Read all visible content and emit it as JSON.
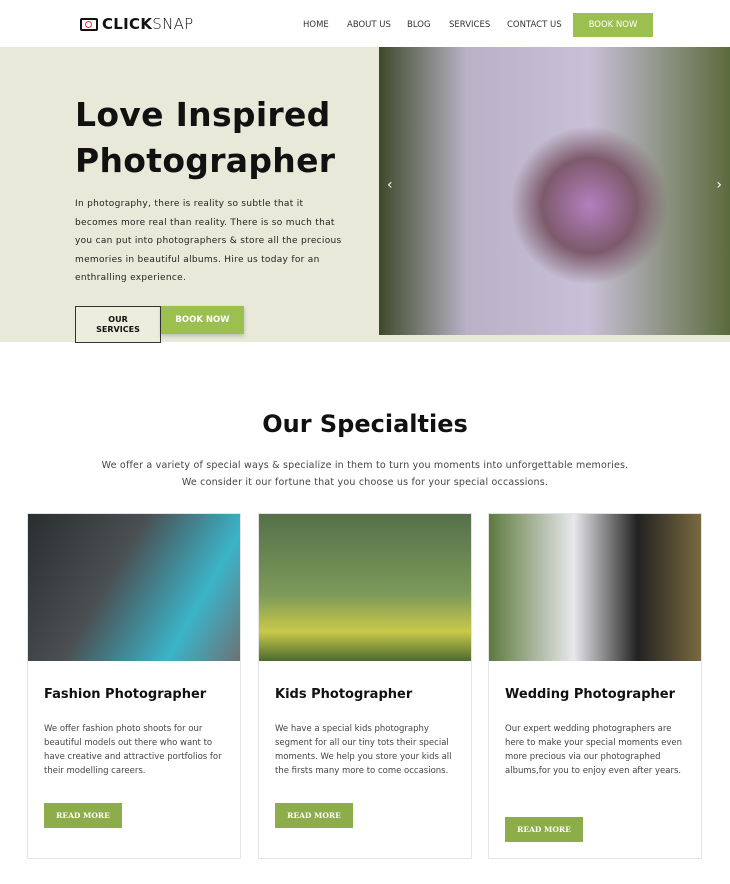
{
  "brand": {
    "bold": "CLICK",
    "light": "SNAP"
  },
  "nav": {
    "items": [
      "HOME",
      "ABOUT US",
      "BLOG",
      "SERVICES",
      "CONTACT US"
    ],
    "book": "BOOK NOW"
  },
  "hero": {
    "title1": "Love Inspired",
    "title2": "Photographer",
    "text": "In photography, there is reality so subtle that it becomes more real than reality. There is so much that you can put into photographers & store all the precious memories in beautiful albums. Hire us today for an enthralling experience.",
    "services": "OUR SERVICES",
    "book": "BOOK NOW",
    "prev": "‹",
    "next": "›"
  },
  "specialties": {
    "title": "Our Specialties",
    "line1": "We offer a variety of special ways & specialize in them to turn you moments into unforgettable memories.",
    "line2": "We consider it our fortune that you choose us for your special occassions.",
    "cards": [
      {
        "title": "Fashion Photographer",
        "text": "We offer fashion photo shoots for our beautiful models out there who want to have creative and attractive portfolios for their modelling careers.",
        "button": "READ MORE"
      },
      {
        "title": "Kids Photographer",
        "text": "We have a special kids photography segment for all our tiny tots their special moments. We help you store your kids all the firsts many more to come occasions.",
        "button": "READ MORE"
      },
      {
        "title": "Wedding Photographer",
        "text": "Our expert wedding photographers are here to make your special moments even more precious via our photographed albums,for you to enjoy even after years.",
        "button": "READ MORE"
      }
    ]
  },
  "colors": {
    "accent": "#9bc04f",
    "hero_bg": "#e8e9d8"
  }
}
